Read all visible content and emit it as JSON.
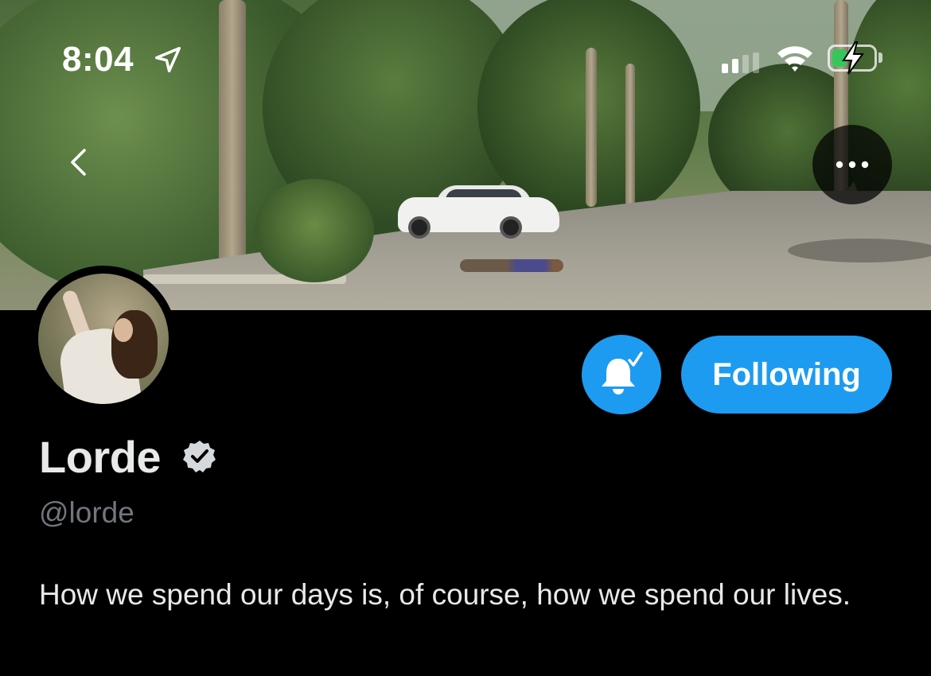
{
  "status_bar": {
    "time": "8:04",
    "location_icon": "location-arrow-icon",
    "signal_icon": "cellular-signal-icon",
    "wifi_icon": "wifi-icon",
    "battery_icon": "battery-charging-icon",
    "battery_level": 0.35,
    "battery_color": "#34c759"
  },
  "nav": {
    "back_icon": "chevron-left-icon",
    "more_icon": "more-horizontal-icon"
  },
  "profile": {
    "display_name": "Lorde",
    "verified_icon": "verified-badge-icon",
    "handle": "@lorde",
    "bio": "How we spend our days is, of course, how we spend our lives."
  },
  "actions": {
    "notifications_icon": "bell-check-icon",
    "following_label": "Following",
    "accent_color": "#1d9bf0"
  }
}
